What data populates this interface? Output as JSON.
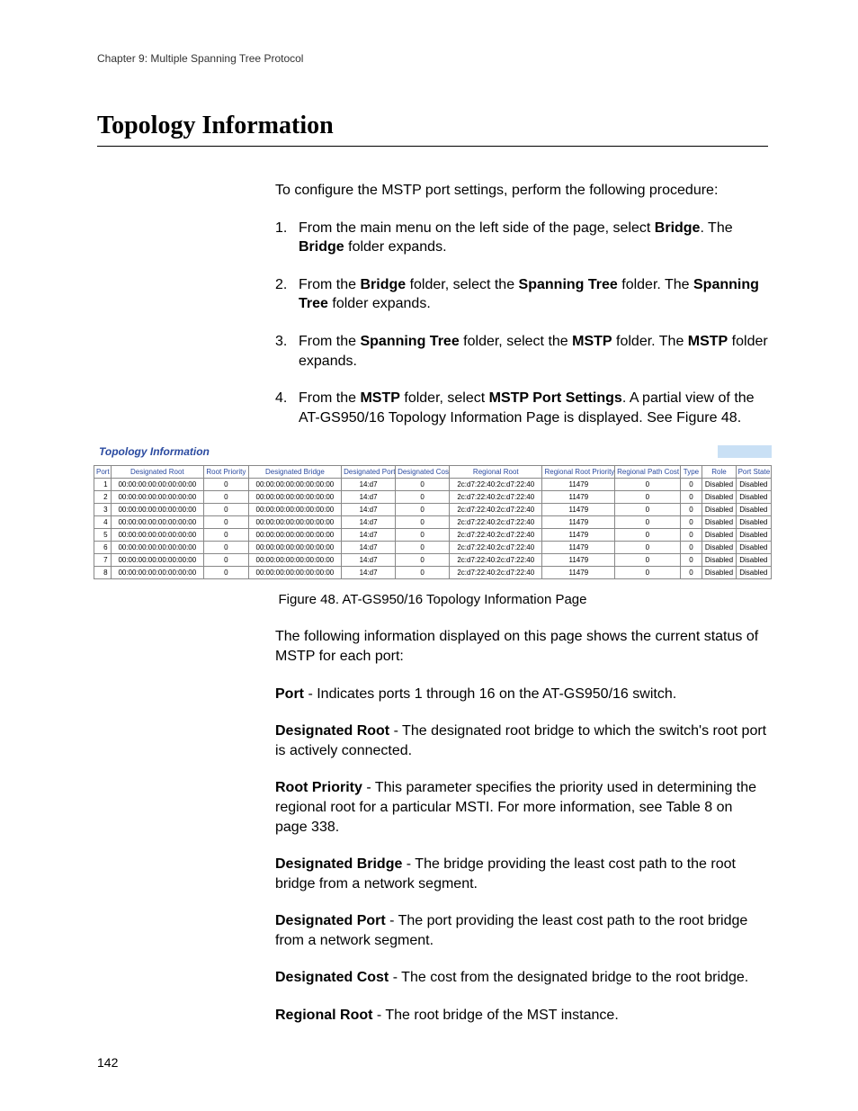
{
  "header": {
    "chapter": "Chapter 9: Multiple Spanning Tree Protocol"
  },
  "title": "Topology Information",
  "intro": "To configure the MSTP port settings, perform the following procedure:",
  "steps": [
    {
      "num": "1.",
      "pre": "From the main menu on the left side of the page, select ",
      "b1": "Bridge",
      "mid": ". The ",
      "b2": "Bridge",
      "post": " folder expands."
    },
    {
      "num": "2.",
      "pre": "From the ",
      "b1": "Bridge",
      "mid": " folder, select the ",
      "b2": "Spanning Tree",
      "post1": " folder. The ",
      "b3": "Spanning Tree",
      "post2": " folder expands."
    },
    {
      "num": "3.",
      "pre": "From the ",
      "b1": "Spanning Tree",
      "mid": " folder, select the ",
      "b2": "MSTP",
      "post1": " folder. The ",
      "b3": "MSTP",
      "post2": " folder expands."
    },
    {
      "num": "4.",
      "pre": "From the ",
      "b1": "MSTP",
      "mid": " folder, select ",
      "b2": "MSTP Port Settings",
      "post": ". A partial view of the AT-GS950/16 Topology Information Page is displayed. See Figure 48."
    }
  ],
  "figure": {
    "title": "Topology Information",
    "caption": "Figure 48. AT-GS950/16 Topology Information Page",
    "columns": [
      "Port",
      "Designated Root",
      "Root Priority",
      "Designated Bridge",
      "Designated Port",
      "Designated Cost",
      "Regional Root",
      "Regional Root Priority",
      "Regional Path Cost",
      "Type",
      "Role",
      "Port State"
    ],
    "rows": [
      {
        "port": "1",
        "dr": "00:00:00:00:00:00:00:00",
        "rp": "0",
        "db": "00:00:00:00:00:00:00:00",
        "dp": "14:d7",
        "dc": "0",
        "rr": "2c:d7:22:40:2c:d7:22:40",
        "rrp": "11479",
        "rpc": "0",
        "type": "0",
        "role": "Disabled",
        "ps": "Disabled"
      },
      {
        "port": "2",
        "dr": "00:00:00:00:00:00:00:00",
        "rp": "0",
        "db": "00:00:00:00:00:00:00:00",
        "dp": "14:d7",
        "dc": "0",
        "rr": "2c:d7:22:40:2c:d7:22:40",
        "rrp": "11479",
        "rpc": "0",
        "type": "0",
        "role": "Disabled",
        "ps": "Disabled"
      },
      {
        "port": "3",
        "dr": "00:00:00:00:00:00:00:00",
        "rp": "0",
        "db": "00:00:00:00:00:00:00:00",
        "dp": "14:d7",
        "dc": "0",
        "rr": "2c:d7:22:40:2c:d7:22:40",
        "rrp": "11479",
        "rpc": "0",
        "type": "0",
        "role": "Disabled",
        "ps": "Disabled"
      },
      {
        "port": "4",
        "dr": "00:00:00:00:00:00:00:00",
        "rp": "0",
        "db": "00:00:00:00:00:00:00:00",
        "dp": "14:d7",
        "dc": "0",
        "rr": "2c:d7:22:40:2c:d7:22:40",
        "rrp": "11479",
        "rpc": "0",
        "type": "0",
        "role": "Disabled",
        "ps": "Disabled"
      },
      {
        "port": "5",
        "dr": "00:00:00:00:00:00:00:00",
        "rp": "0",
        "db": "00:00:00:00:00:00:00:00",
        "dp": "14:d7",
        "dc": "0",
        "rr": "2c:d7:22:40:2c:d7:22:40",
        "rrp": "11479",
        "rpc": "0",
        "type": "0",
        "role": "Disabled",
        "ps": "Disabled"
      },
      {
        "port": "6",
        "dr": "00:00:00:00:00:00:00:00",
        "rp": "0",
        "db": "00:00:00:00:00:00:00:00",
        "dp": "14:d7",
        "dc": "0",
        "rr": "2c:d7:22:40:2c:d7:22:40",
        "rrp": "11479",
        "rpc": "0",
        "type": "0",
        "role": "Disabled",
        "ps": "Disabled"
      },
      {
        "port": "7",
        "dr": "00:00:00:00:00:00:00:00",
        "rp": "0",
        "db": "00:00:00:00:00:00:00:00",
        "dp": "14:d7",
        "dc": "0",
        "rr": "2c:d7:22:40:2c:d7:22:40",
        "rrp": "11479",
        "rpc": "0",
        "type": "0",
        "role": "Disabled",
        "ps": "Disabled"
      },
      {
        "port": "8",
        "dr": "00:00:00:00:00:00:00:00",
        "rp": "0",
        "db": "00:00:00:00:00:00:00:00",
        "dp": "14:d7",
        "dc": "0",
        "rr": "2c:d7:22:40:2c:d7:22:40",
        "rrp": "11479",
        "rpc": "0",
        "type": "0",
        "role": "Disabled",
        "ps": "Disabled"
      }
    ]
  },
  "following_text": "The following information displayed on this page shows the current status of MSTP for each port:",
  "definitions": [
    {
      "term": "Port",
      "desc": " - Indicates ports 1 through 16 on the AT-GS950/16 switch."
    },
    {
      "term": "Designated Root",
      "desc": " - The designated root bridge to which the switch's root port is actively connected."
    },
    {
      "term": "Root Priority",
      "desc": " - This parameter specifies the priority used in determining the regional root for a particular MSTI. For more information, see Table 8 on page 338."
    },
    {
      "term": "Designated Bridge",
      "desc": " - The bridge providing the least cost path to the root bridge from a network segment."
    },
    {
      "term": "Designated Port",
      "desc": " - The port providing the least cost path to the root bridge from a network segment."
    },
    {
      "term": "Designated Cost",
      "desc": " - The cost from the designated bridge to the root bridge."
    },
    {
      "term": "Regional Root",
      "desc": " - The root bridge of the MST instance."
    }
  ],
  "page_number": "142"
}
